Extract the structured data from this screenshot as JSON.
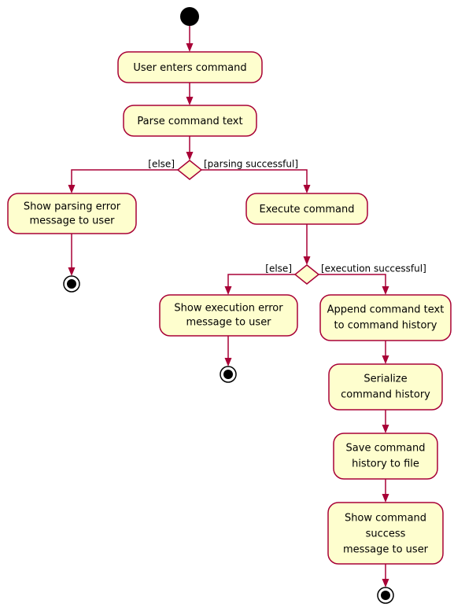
{
  "diagram": {
    "type": "uml-activity-diagram",
    "colors": {
      "node_fill": "#FEFECE",
      "node_border": "#A80036",
      "edge": "#A80036",
      "text": "#000000",
      "background": "#FFFFFF",
      "terminal": "#000000"
    },
    "start_node": {
      "name": "initial-node"
    },
    "activities": [
      {
        "id": "user-enters-command",
        "lines": [
          "User enters command"
        ]
      },
      {
        "id": "parse-command-text",
        "lines": [
          "Parse command text"
        ]
      },
      {
        "id": "show-parsing-error",
        "lines": [
          "Show parsing error",
          "message to user"
        ]
      },
      {
        "id": "execute-command",
        "lines": [
          "Execute command"
        ]
      },
      {
        "id": "show-execution-error",
        "lines": [
          "Show execution error",
          "message to user"
        ]
      },
      {
        "id": "append-command-text",
        "lines": [
          "Append command text",
          "to command history"
        ]
      },
      {
        "id": "serialize-command-history",
        "lines": [
          "Serialize",
          "command history"
        ]
      },
      {
        "id": "save-command-history",
        "lines": [
          "Save command",
          "history to file"
        ]
      },
      {
        "id": "show-command-success",
        "lines": [
          "Show command",
          "success",
          "message to user"
        ]
      }
    ],
    "decisions": [
      {
        "id": "parsing-decision",
        "guard_left": "[else]",
        "guard_right": "[parsing successful]"
      },
      {
        "id": "execution-decision",
        "guard_left": "[else]",
        "guard_right": "[execution successful]"
      }
    ],
    "end_nodes": [
      {
        "id": "end-node-parsing-error"
      },
      {
        "id": "end-node-execution-error"
      },
      {
        "id": "end-node-success"
      }
    ]
  }
}
